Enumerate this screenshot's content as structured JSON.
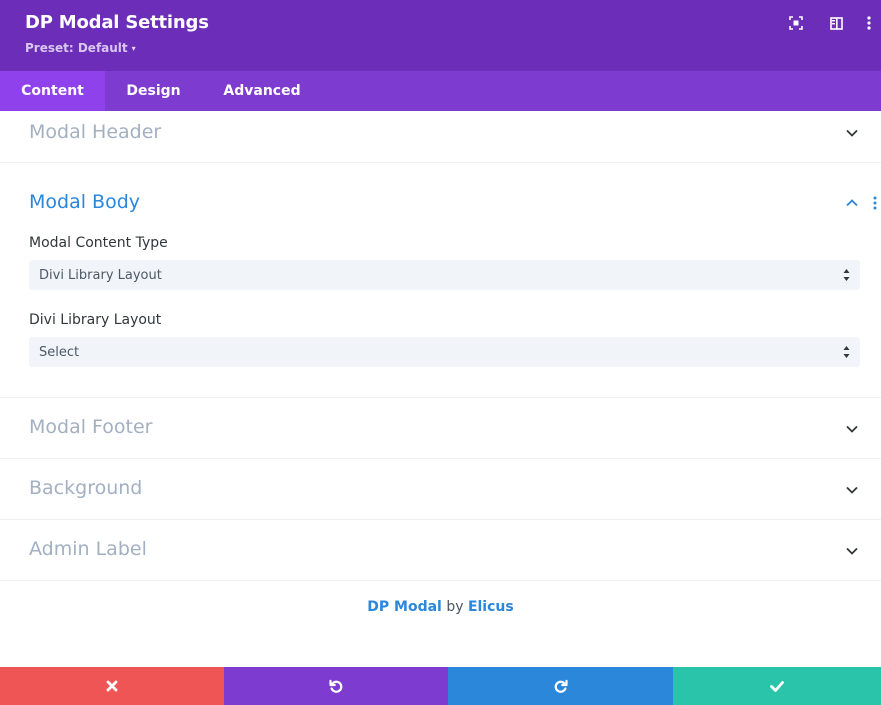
{
  "header": {
    "title": "DP Modal Settings",
    "preset_label": "Preset: Default",
    "icons": [
      "expand-icon",
      "sidebar-toggle-icon",
      "more-options-icon"
    ]
  },
  "tabs": [
    {
      "label": "Content",
      "active": true
    },
    {
      "label": "Design",
      "active": false
    },
    {
      "label": "Advanced",
      "active": false
    }
  ],
  "sections": {
    "modal_header": {
      "title": "Modal Header",
      "expanded": false
    },
    "modal_body": {
      "title": "Modal Body",
      "expanded": true,
      "content_type_label": "Modal Content Type",
      "content_type_value": "Divi Library Layout",
      "layout_label": "Divi Library Layout",
      "layout_value": "Select"
    },
    "modal_footer": {
      "title": "Modal Footer",
      "expanded": false
    },
    "background": {
      "title": "Background",
      "expanded": false
    },
    "admin_label": {
      "title": "Admin Label",
      "expanded": false
    }
  },
  "credit": {
    "product": "DP Modal",
    "by": "by",
    "author": "Elicus"
  },
  "footer": {
    "buttons": [
      "cancel",
      "undo",
      "redo",
      "save"
    ]
  },
  "colors": {
    "header": "#6c2eb9",
    "tabs": "#7e3bd0",
    "active_tab": "#8f42ec",
    "accent": "#2b87da",
    "cancel": "#ef5555",
    "undo": "#7d3bcf",
    "redo": "#2b87da",
    "save": "#29c4a9"
  }
}
